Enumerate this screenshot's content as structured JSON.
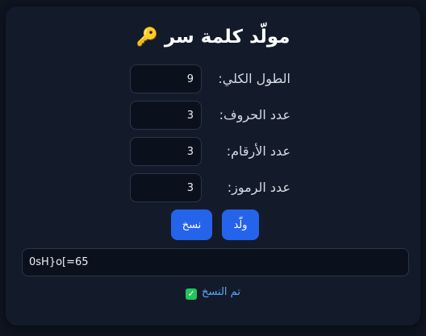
{
  "header": {
    "title": "مولّد كلمة سر",
    "icon": "key-icon",
    "icon_glyph": "🔑"
  },
  "fields": [
    {
      "label": "الطول الكلي:",
      "value": "9"
    },
    {
      "label": "عدد الحروف:",
      "value": "3"
    },
    {
      "label": "عدد الأرقام:",
      "value": "3"
    },
    {
      "label": "عدد الرموز:",
      "value": "3"
    }
  ],
  "buttons": {
    "generate_label": "ولّد",
    "copy_label": "نسخ"
  },
  "output": {
    "value": "0sH}o[=65"
  },
  "status": {
    "text": "تم النسخ",
    "icon": "check-icon",
    "icon_glyph": "✓"
  },
  "colors": {
    "page_background": "#0e1420",
    "card_background": "#131b2b",
    "accent": "#2563eb",
    "status_text": "#60a5fa",
    "success": "#22c55e"
  }
}
